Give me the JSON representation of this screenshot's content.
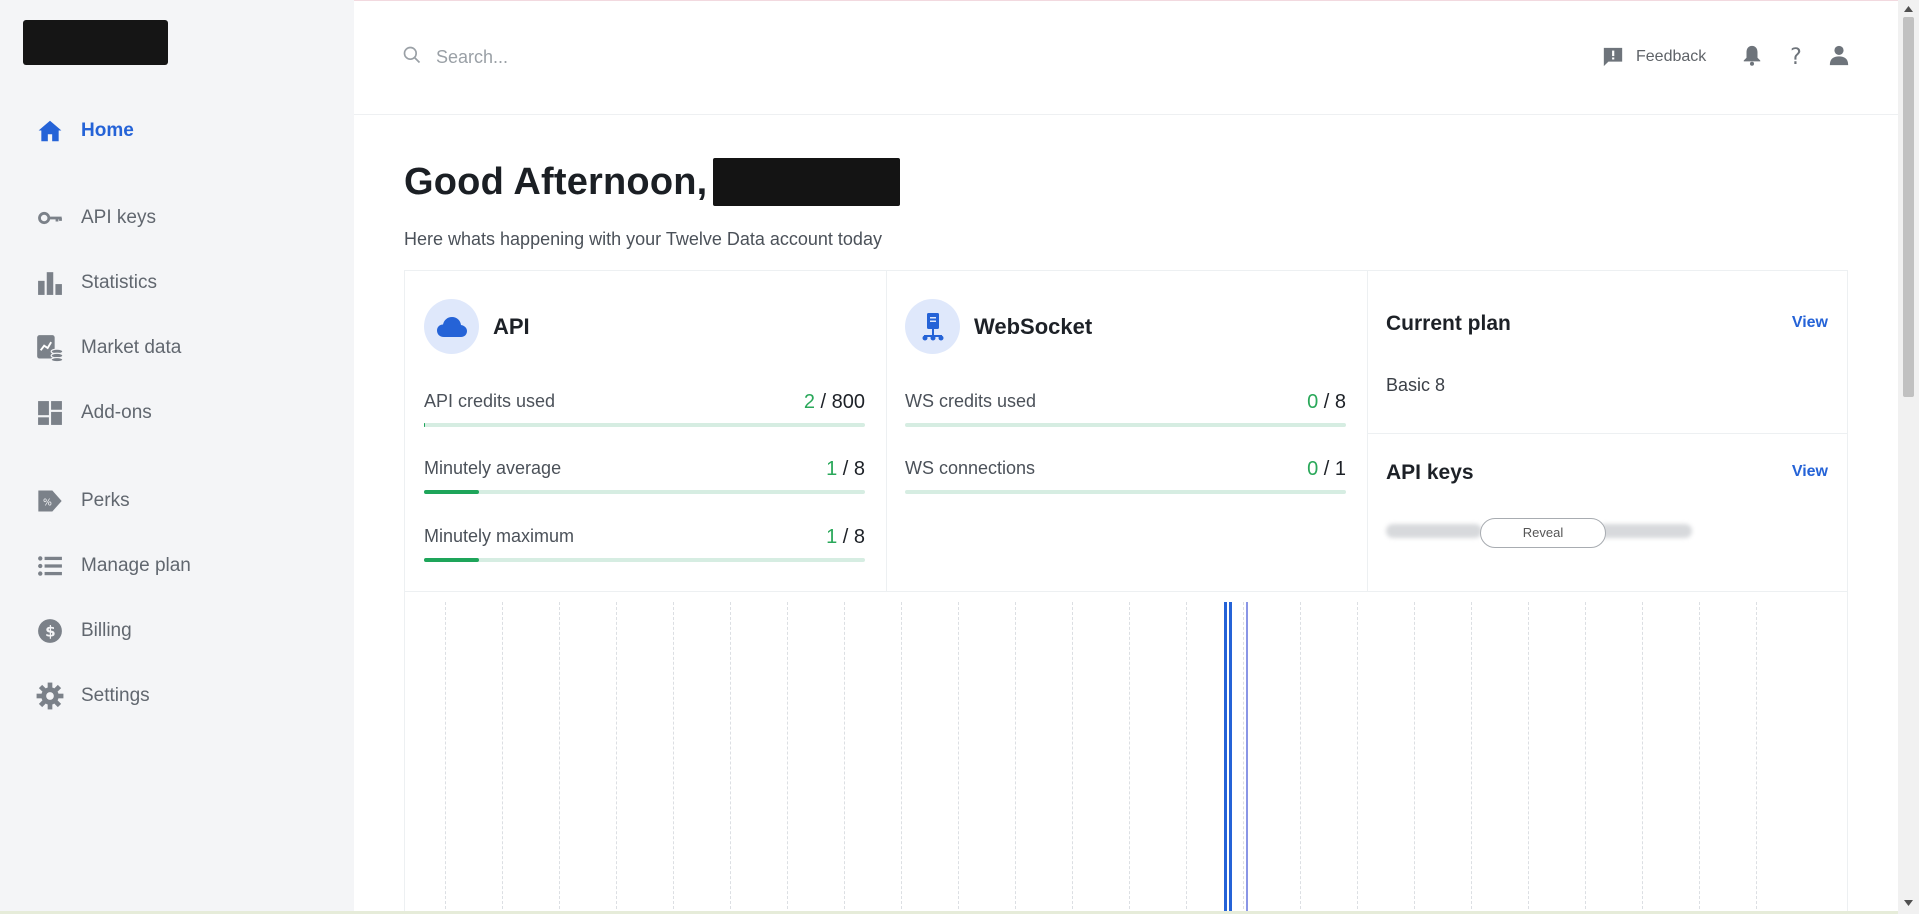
{
  "sidebar": {
    "items": [
      {
        "label": "Home",
        "icon": "home-icon"
      },
      {
        "label": "API keys",
        "icon": "key-icon"
      },
      {
        "label": "Statistics",
        "icon": "bar-chart-icon"
      },
      {
        "label": "Market data",
        "icon": "market-data-icon"
      },
      {
        "label": "Add-ons",
        "icon": "grid-icon"
      },
      {
        "label": "Perks",
        "icon": "perks-tag-icon"
      },
      {
        "label": "Manage plan",
        "icon": "list-icon"
      },
      {
        "label": "Billing",
        "icon": "dollar-icon"
      },
      {
        "label": "Settings",
        "icon": "gear-icon"
      }
    ],
    "active": "Home"
  },
  "header": {
    "search_placeholder": "Search...",
    "feedback_label": "Feedback"
  },
  "greeting": {
    "text": "Good Afternoon,",
    "subtitle": "Here whats happening with your Twelve Data account today"
  },
  "api_card": {
    "title": "API",
    "metrics": [
      {
        "label": "API credits used",
        "used": "2",
        "total": "800",
        "fill_fraction": 0.0025
      },
      {
        "label": "Minutely average",
        "used": "1",
        "total": "8",
        "fill_fraction": 0.125
      },
      {
        "label": "Minutely maximum",
        "used": "1",
        "total": "8",
        "fill_fraction": 0.125
      }
    ]
  },
  "ws_card": {
    "title": "WebSocket",
    "metrics": [
      {
        "label": "WS credits used",
        "used": "0",
        "total": "8",
        "fill_fraction": 0
      },
      {
        "label": "WS connections",
        "used": "0",
        "total": "1",
        "fill_fraction": 0
      }
    ]
  },
  "plan_card": {
    "title": "Current plan",
    "view_label": "View",
    "plan_name": "Basic 8"
  },
  "keys_card": {
    "title": "API keys",
    "view_label": "View",
    "reveal_label": "Reveal"
  },
  "colors": {
    "accent": "#2563d7",
    "used_green": "#2aa85a",
    "bar_track": "#d6ede2",
    "bar_fill": "#1ea55a",
    "sidebar_bg": "#f4f5f7"
  }
}
